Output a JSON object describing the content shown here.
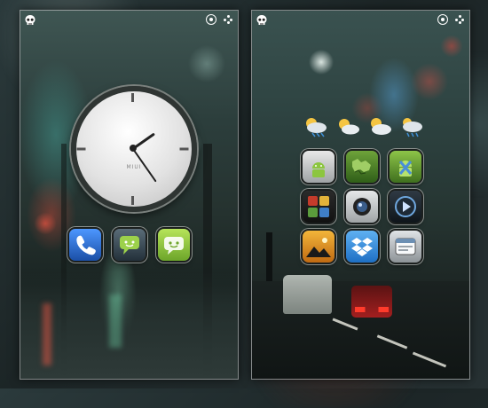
{
  "screens": [
    {
      "id": "left",
      "statusbar": {
        "left_icon": "skull-icon",
        "right_icons": [
          "target-icon",
          "dots-icon"
        ]
      },
      "clock": {
        "brand": "MIUI",
        "hour": 1,
        "minute": 25
      },
      "dock": [
        {
          "icon": "phone-icon",
          "color": "#2a6fd0"
        },
        {
          "icon": "messaging-icon",
          "color": "#8fbf3a"
        },
        {
          "icon": "android-messaging-icon",
          "color": "#9fcf45"
        }
      ]
    },
    {
      "id": "right",
      "statusbar": {
        "left_icon": "skull-icon",
        "right_icons": [
          "target-icon",
          "dots-icon"
        ]
      },
      "weather": [
        "thunderstorm-icon",
        "partly-sunny-icon",
        "partly-sunny-icon",
        "rain-cloud-icon"
      ],
      "apps": [
        [
          "android-market-icon",
          "world-map-icon",
          "android-x-icon"
        ],
        [
          "app-grid-icon",
          "camera-icon",
          "media-player-icon"
        ],
        [
          "landscape-icon",
          "dropbox-icon",
          "browser-icon"
        ]
      ]
    }
  ],
  "colors": {
    "accent": "#8fbf3a",
    "frame": "#ffffff"
  }
}
